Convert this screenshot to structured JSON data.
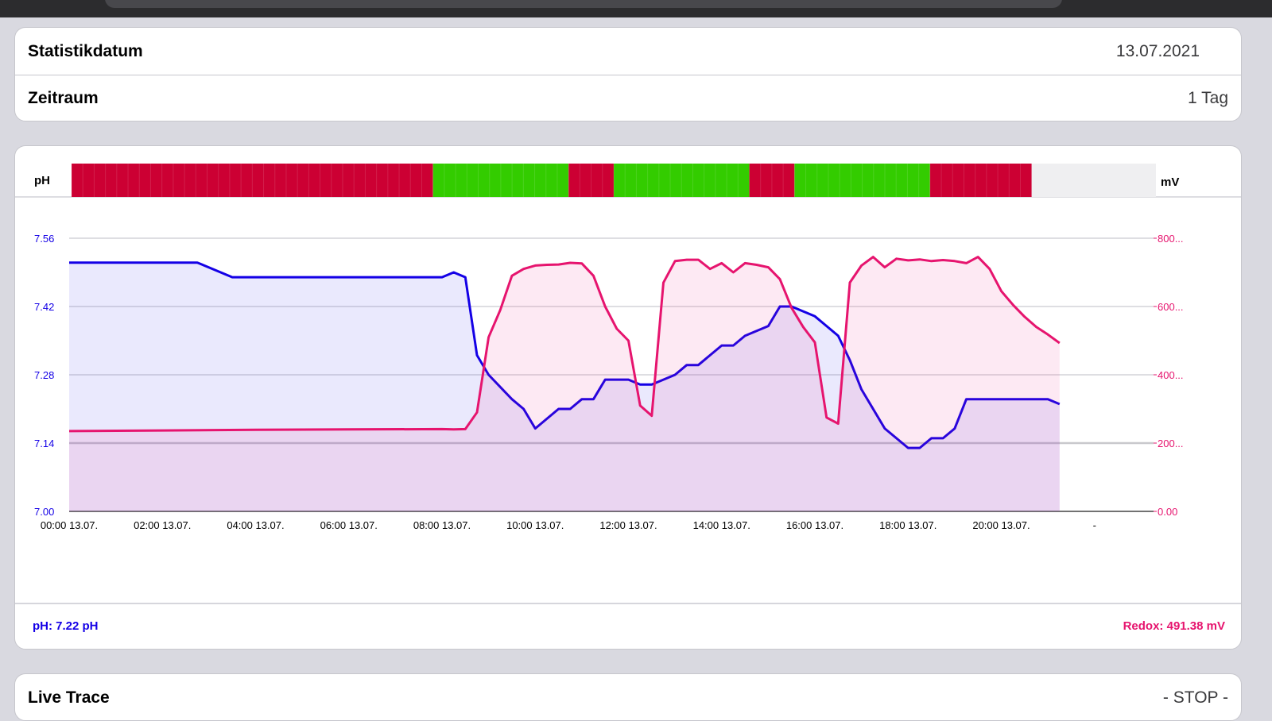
{
  "settings": {
    "stat_date_label": "Statistikdatum",
    "stat_date_value": "13.07.2021",
    "period_label": "Zeitraum",
    "period_value": "1 Tag"
  },
  "chart": {
    "left_unit": "pH",
    "right_unit": "mV",
    "colors": {
      "ph": "#1400e6",
      "redox": "#e6146e",
      "status_bad": "#cc0033",
      "status_good": "#33cc00",
      "status_none": "#efeff1"
    },
    "status_bar": [
      {
        "from": 0,
        "to": 8,
        "state": "bad"
      },
      {
        "from": 8,
        "to": 11,
        "state": "good"
      },
      {
        "from": 11,
        "to": 12,
        "state": "bad"
      },
      {
        "from": 12,
        "to": 15,
        "state": "good"
      },
      {
        "from": 15,
        "to": 16,
        "state": "bad"
      },
      {
        "from": 16,
        "to": 19,
        "state": "good"
      },
      {
        "from": 19,
        "to": 21.25,
        "state": "bad"
      },
      {
        "from": 21.25,
        "to": 24,
        "state": "none"
      }
    ],
    "x_ticks": [
      "00:00 13.07.",
      "02:00 13.07.",
      "04:00 13.07.",
      "06:00 13.07.",
      "08:00 13.07.",
      "10:00 13.07.",
      "12:00 13.07.",
      "14:00 13.07.",
      "16:00 13.07.",
      "18:00 13.07.",
      "20:00 13.07.",
      "-"
    ],
    "y_left_ticks": [
      "7.00",
      "7.14",
      "7.28",
      "7.42",
      "7.56"
    ],
    "y_right_ticks": [
      "0.00",
      "200...",
      "400...",
      "600...",
      "800..."
    ],
    "footer_ph": "pH: 7.22 pH",
    "footer_redox": "Redox: 491.38 mV"
  },
  "chart_data": {
    "type": "area",
    "x_unit": "hours",
    "xlim": [
      0,
      24
    ],
    "y_left": {
      "unit": "pH",
      "lim": [
        7.0,
        7.56
      ]
    },
    "y_right": {
      "unit": "mV",
      "lim": [
        0,
        800
      ]
    },
    "series": [
      {
        "name": "pH",
        "axis": "left",
        "x": [
          0,
          2.75,
          3.5,
          5,
          8,
          8.25,
          8.5,
          8.75,
          9,
          9.5,
          9.75,
          10,
          10.5,
          10.75,
          11,
          11.25,
          11.5,
          12,
          12.25,
          12.5,
          12.75,
          13,
          13.25,
          13.5,
          13.75,
          14,
          14.25,
          14.5,
          14.75,
          15,
          15.25,
          15.5,
          15.75,
          16,
          16.25,
          16.5,
          16.75,
          17,
          17.5,
          18,
          18.25,
          18.5,
          18.75,
          19,
          19.25,
          19.5,
          20,
          20.5,
          21,
          21.25
        ],
        "y": [
          7.51,
          7.51,
          7.48,
          7.48,
          7.48,
          7.49,
          7.48,
          7.32,
          7.28,
          7.23,
          7.21,
          7.17,
          7.21,
          7.21,
          7.23,
          7.23,
          7.27,
          7.27,
          7.26,
          7.26,
          7.27,
          7.28,
          7.3,
          7.3,
          7.32,
          7.34,
          7.34,
          7.36,
          7.37,
          7.38,
          7.42,
          7.42,
          7.41,
          7.4,
          7.38,
          7.36,
          7.31,
          7.25,
          7.17,
          7.13,
          7.13,
          7.15,
          7.15,
          7.17,
          7.23,
          7.23,
          7.23,
          7.23,
          7.23,
          7.22
        ]
      },
      {
        "name": "Redox",
        "axis": "right",
        "x": [
          0,
          2,
          4,
          6,
          8,
          8.25,
          8.5,
          8.75,
          9,
          9.25,
          9.5,
          9.75,
          10,
          10.25,
          10.5,
          10.75,
          11,
          11.25,
          11.5,
          11.75,
          12,
          12.25,
          12.5,
          12.75,
          13,
          13.25,
          13.5,
          13.75,
          14,
          14.25,
          14.5,
          14.75,
          15,
          15.25,
          15.5,
          15.75,
          16,
          16.25,
          16.5,
          16.75,
          17,
          17.25,
          17.5,
          17.75,
          18,
          18.25,
          18.5,
          18.75,
          19,
          19.25,
          19.5,
          19.75,
          20,
          20.25,
          20.5,
          20.75,
          21,
          21.25
        ],
        "y": [
          235,
          237,
          239,
          240,
          241,
          240,
          241,
          290,
          510,
          590,
          690,
          710,
          720,
          722,
          723,
          728,
          726,
          690,
          600,
          535,
          500,
          310,
          280,
          670,
          733,
          737,
          737,
          710,
          727,
          700,
          727,
          722,
          715,
          680,
          596,
          540,
          495,
          275,
          257,
          670,
          720,
          745,
          715,
          740,
          735,
          738,
          733,
          736,
          733,
          727,
          745,
          710,
          645,
          605,
          570,
          540,
          518,
          493
        ]
      }
    ]
  }
}
